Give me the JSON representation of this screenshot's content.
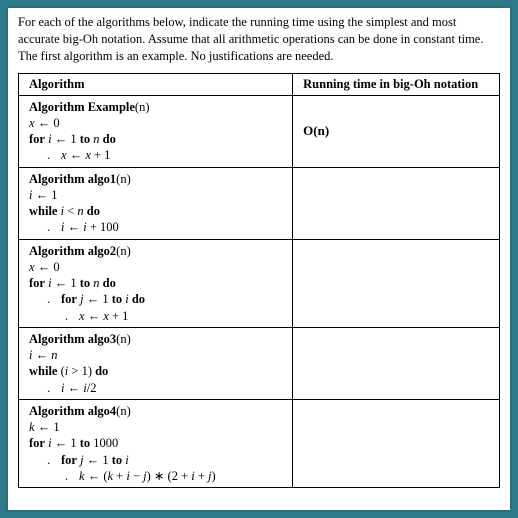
{
  "instructions": "For each of the algorithms below, indicate the running time using the simplest and most accurate big-Oh notation. Assume that all arithmetic operations can be done in constant time. The first algorithm is an example. No justifications are needed.",
  "headers": {
    "algorithm": "Algorithm",
    "running_time": "Running time in big-Oh notation"
  },
  "rows": [
    {
      "title_word": "Algorithm",
      "title_name": "Example",
      "title_arg": "(n)",
      "lines": [
        {
          "indent": 1,
          "tokens": [
            "<it>x</it> ← 0"
          ]
        },
        {
          "indent": 1,
          "tokens": [
            "<kw>for</kw> <it>i</it> ← 1 <kw>to</kw> <it>n</it> <kw>do</kw>"
          ]
        },
        {
          "indent": 2,
          "dot": true,
          "tokens": [
            "<it>x</it> ← <it>x</it> + 1"
          ]
        }
      ],
      "running_time": "O(n)"
    },
    {
      "title_word": "Algorithm",
      "title_name": "algo1",
      "title_arg": "(n)",
      "lines": [
        {
          "indent": 1,
          "tokens": [
            "<it>i</it> ← 1"
          ]
        },
        {
          "indent": 1,
          "tokens": [
            "<kw>while</kw> <it>i</it> &lt; <it>n</it> <kw>do</kw>"
          ]
        },
        {
          "indent": 2,
          "dot": true,
          "tokens": [
            "<it>i</it> ← <it>i</it> + 100"
          ]
        }
      ],
      "running_time": ""
    },
    {
      "title_word": "Algorithm",
      "title_name": "algo2",
      "title_arg": "(n)",
      "lines": [
        {
          "indent": 1,
          "tokens": [
            "<it>x</it> ← 0"
          ]
        },
        {
          "indent": 1,
          "tokens": [
            "<kw>for</kw> <it>i</it> ← 1 <kw>to</kw> <it>n</it> <kw>do</kw>"
          ]
        },
        {
          "indent": 2,
          "dot": true,
          "tokens": [
            "<kw>for</kw> <it>j</it> ← 1 <kw>to</kw> <it>i</it> <kw>do</kw>"
          ]
        },
        {
          "indent": 3,
          "dot": true,
          "tokens": [
            "<it>x</it> ← <it>x</it> + 1"
          ]
        }
      ],
      "running_time": ""
    },
    {
      "title_word": "Algorithm",
      "title_name": "algo3",
      "title_arg": "(n)",
      "lines": [
        {
          "indent": 1,
          "tokens": [
            "<it>i</it> ← <it>n</it>"
          ]
        },
        {
          "indent": 1,
          "tokens": [
            "<kw>while</kw> (<it>i</it> &gt; 1) <kw>do</kw>"
          ]
        },
        {
          "indent": 2,
          "dot": true,
          "tokens": [
            "<it>i</it> ← <it>i</it>/2"
          ]
        }
      ],
      "running_time": ""
    },
    {
      "title_word": "Algorithm",
      "title_name": "algo4",
      "title_arg": "(n)",
      "lines": [
        {
          "indent": 1,
          "tokens": [
            "<it>k</it> ← 1"
          ]
        },
        {
          "indent": 1,
          "tokens": [
            "<kw>for</kw> <it>i</it> ← 1 <kw>to</kw> 1000"
          ]
        },
        {
          "indent": 2,
          "dot": true,
          "tokens": [
            "<kw>for</kw> <it>j</it> ← 1 <kw>to</kw> <it>i</it>"
          ]
        },
        {
          "indent": 3,
          "dot": true,
          "tokens": [
            "<it>k</it> ← (<it>k</it> + <it>i</it> − <it>j</it>) ∗ (2 + <it>i</it> + <it>j</it>)"
          ]
        }
      ],
      "running_time": ""
    }
  ]
}
